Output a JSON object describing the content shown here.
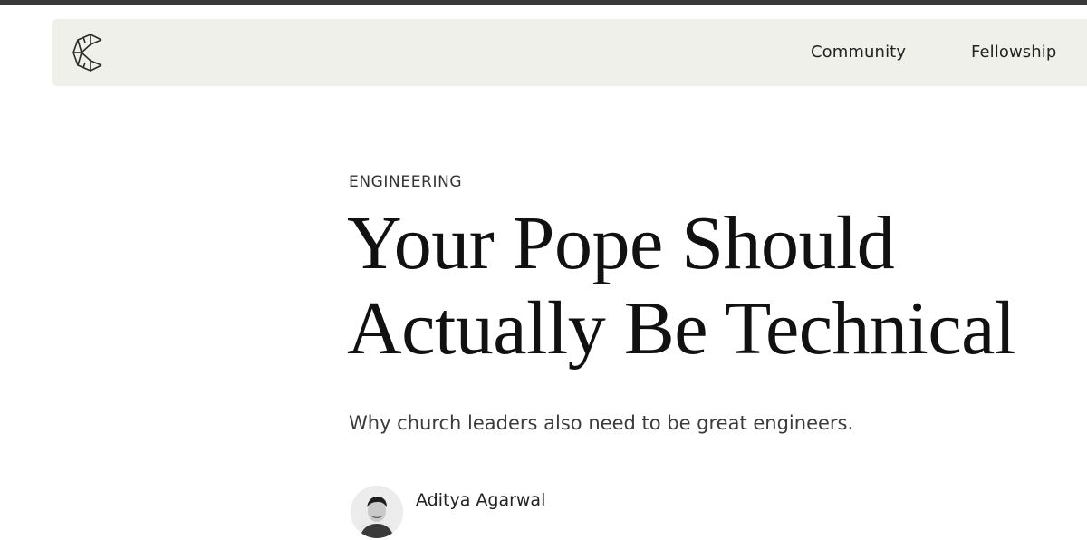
{
  "nav": {
    "logo_icon": "community-c-logo-icon",
    "links": [
      "Community",
      "Fellowship"
    ]
  },
  "article": {
    "category": "ENGINEERING",
    "title_lines": [
      "Your Pope Should",
      "Actually Be Technical"
    ],
    "subtitle": "Why church leaders also need to be great engineers.",
    "author": {
      "name": "Aditya Agarwal",
      "avatar_icon": "author-avatar"
    }
  },
  "colors": {
    "top_rule": "#3a3a3a",
    "navbar_bg": "#f0f0eb",
    "text": "#111111"
  }
}
